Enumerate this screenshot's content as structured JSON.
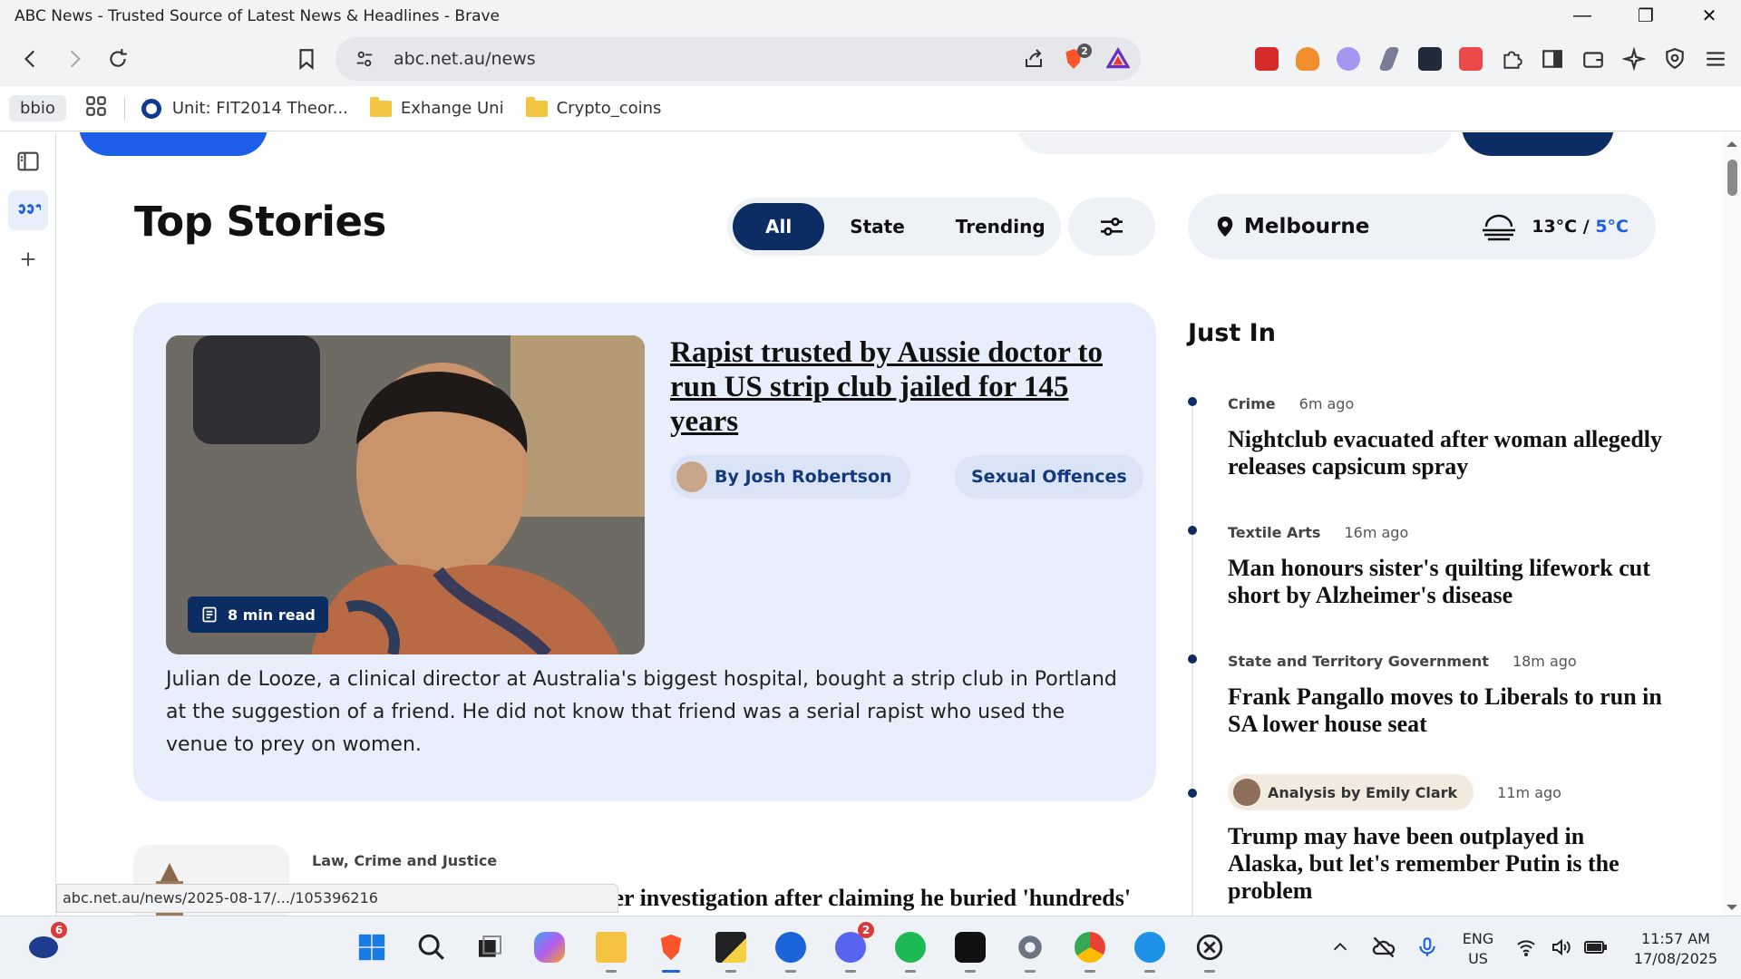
{
  "window": {
    "title": "ABC News - Trusted Source of Latest News & Headlines - Brave",
    "minimize": "—",
    "restore": "❐",
    "close": "✕"
  },
  "address_bar": {
    "url": "abc.net.au/news",
    "brave_shield_count": "2"
  },
  "bookmarks": {
    "profile_chip": "bbio",
    "items": [
      {
        "label": "Unit: FIT2014 Theor...",
        "icon": "circle-icon"
      },
      {
        "label": "Exhange Uni",
        "icon": "folder-icon"
      },
      {
        "label": "Crypto_coins",
        "icon": "folder-icon"
      }
    ]
  },
  "page": {
    "section_title": "Top Stories",
    "filters": [
      "All",
      "State",
      "Trending"
    ],
    "active_filter": "All",
    "weather": {
      "location": "Melbourne",
      "high": "13°C",
      "separator": "/",
      "low": "5°C"
    },
    "main_story": {
      "headline": "Rapist trusted by Aussie doctor to run US strip club jailed for 145 years",
      "author": "By Josh Robertson",
      "topic": "Sexual Offences",
      "read_time": "8 min read",
      "summary": "Julian de Looze, a clinical director at Australia's biggest hospital, bought a strip club in Portland at the suggestion of a friend.  He did not know that friend was a serial rapist who used the venue to prey on women."
    },
    "second_story": {
      "category": "Law, Crime and Justice",
      "headline_partial": "der investigation after claiming he buried 'hundreds'"
    },
    "just_in": {
      "title": "Just In",
      "items": [
        {
          "category": "Crime",
          "time": "6m ago",
          "headline": "Nightclub evacuated after woman allegedly releases capsicum spray"
        },
        {
          "category": "Textile Arts",
          "time": "16m ago",
          "headline": "Man honours sister's quilting lifework cut short by Alzheimer's disease"
        },
        {
          "category": "State and Territory Government",
          "time": "18m ago",
          "headline": "Frank Pangallo moves to Liberals to run in SA lower house seat"
        },
        {
          "category": "Analysis by Emily Clark",
          "time": "11m ago",
          "headline": "Trump may have been outplayed in Alaska, but let's remember Putin is the problem"
        }
      ]
    }
  },
  "status_bar": {
    "hover_url": "abc.net.au/news/2025-08-17/.../105396216"
  },
  "taskbar": {
    "afl_badge": "6",
    "discord_badge": "2",
    "language": "ENG",
    "region": "US",
    "time": "11:57 AM",
    "date": "17/08/2025"
  },
  "colors": {
    "abc_navy": "#0c2d63",
    "abc_blue": "#1f5ee8",
    "card_bg": "#e8eefb"
  }
}
